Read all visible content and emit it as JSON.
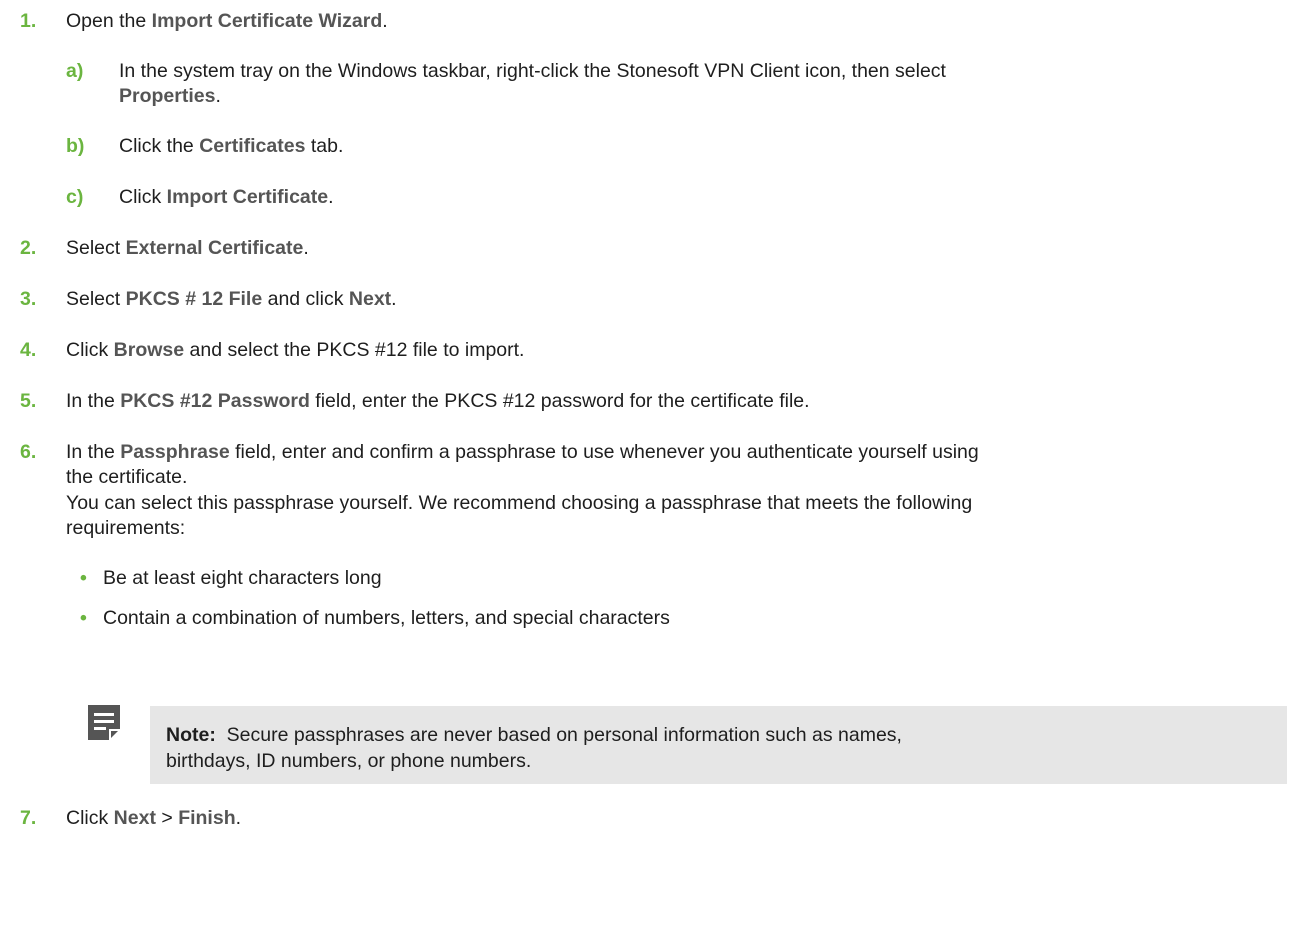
{
  "steps": [
    {
      "num": "1.",
      "parts": [
        "Open the ",
        "Import Certificate Wizard",
        "."
      ],
      "substeps": [
        {
          "num": "a)",
          "line1": [
            "In the system tray on the Windows taskbar, right-click the Stonesoft VPN Client icon, then select"
          ],
          "line2": [
            "Properties",
            "."
          ]
        },
        {
          "num": "b)",
          "parts": [
            "Click the ",
            "Certificates",
            " tab."
          ]
        },
        {
          "num": "c)",
          "parts": [
            "Click ",
            "Import Certificate",
            "."
          ]
        }
      ]
    },
    {
      "num": "2.",
      "parts": [
        "Select ",
        "External Certificate",
        "."
      ]
    },
    {
      "num": "3.",
      "parts": [
        "Select ",
        "PKCS # 12 File",
        " and click ",
        "Next",
        "."
      ]
    },
    {
      "num": "4.",
      "parts": [
        "Click ",
        "Browse",
        " and select the PKCS #12 file to import."
      ]
    },
    {
      "num": "5.",
      "parts": [
        "In the ",
        "PKCS #12 Password",
        " field, enter the PKCS #12 password for the certificate file."
      ]
    },
    {
      "num": "6.",
      "line1": [
        "In the ",
        "Passphrase",
        " field, enter and confirm a passphrase to use whenever you authenticate yourself using"
      ],
      "line2": "the certificate.",
      "para_line1": "You can select this passphrase yourself. We recommend choosing a passphrase that meets the following",
      "para_line2": "requirements:",
      "bullets": [
        "Be at least eight characters long",
        "Contain a combination of numbers, letters, and special characters"
      ]
    },
    {
      "num": "7.",
      "parts": [
        "Click ",
        "Next",
        " > ",
        "Finish",
        "."
      ]
    }
  ],
  "note": {
    "label": "Note:",
    "line1": "Secure passphrases are never based on personal information such as names,",
    "line2": "birthdays, ID numbers, or phone numbers.",
    "icon": "note-icon"
  },
  "colors": {
    "accent_green": "#6bb540",
    "ui_gray": "#555555",
    "note_bg": "#e6e6e6",
    "icon_dark": "#555555"
  }
}
